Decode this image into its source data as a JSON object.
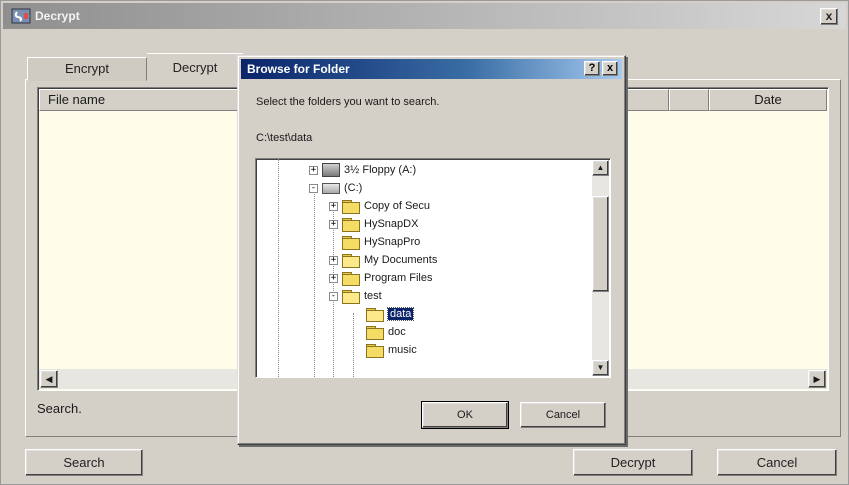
{
  "main_window": {
    "title": "Decrypt",
    "close_glyph": "x"
  },
  "tabs": [
    {
      "label": "Encrypt",
      "active": false
    },
    {
      "label": "Decrypt",
      "active": true
    }
  ],
  "file_list": {
    "columns": [
      "File name",
      "",
      "Date"
    ],
    "rows": []
  },
  "status": {
    "text": "Search."
  },
  "buttons": {
    "search": "Search",
    "decrypt": "Decrypt",
    "cancel": "Cancel"
  },
  "dialog": {
    "title": "Browse for Folder",
    "help_glyph": "?",
    "close_glyph": "x",
    "prompt": "Select the folders you want to search.",
    "path": "C:\\test\\data",
    "tree": [
      {
        "label": "3½ Floppy (A:)",
        "icon": "floppy-icon",
        "expander": "+"
      },
      {
        "label": "(C:)",
        "icon": "drive-icon",
        "expander": "-"
      },
      {
        "label": "Copy of Secu",
        "icon": "folder-icon",
        "expander": "+"
      },
      {
        "label": "HySnapDX",
        "icon": "folder-icon",
        "expander": "+"
      },
      {
        "label": "HySnapPro",
        "icon": "folder-icon",
        "expander": ""
      },
      {
        "label": "My Documents",
        "icon": "my-documents-icon",
        "expander": "+"
      },
      {
        "label": "Program Files",
        "icon": "folder-icon",
        "expander": "+"
      },
      {
        "label": "test",
        "icon": "folder-open-icon",
        "expander": "-"
      },
      {
        "label": "data",
        "icon": "folder-open-icon",
        "expander": "",
        "selected": true
      },
      {
        "label": "doc",
        "icon": "folder-icon",
        "expander": ""
      },
      {
        "label": "music",
        "icon": "folder-icon",
        "expander": ""
      }
    ],
    "ok_label": "OK",
    "cancel_label": "Cancel"
  },
  "colors": {
    "list_background": "#fdfde9",
    "dialog_title_start": "#0a246a",
    "dialog_title_end": "#a6caf0",
    "selection": "#0a246a"
  }
}
